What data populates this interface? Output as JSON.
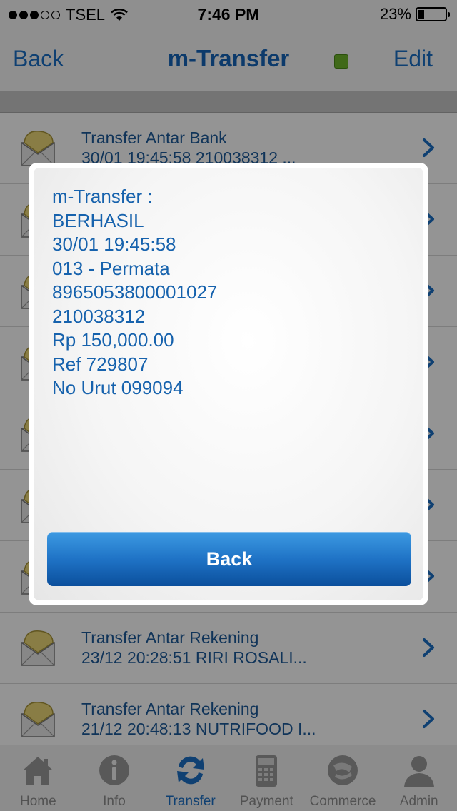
{
  "status_bar": {
    "carrier": "TSEL",
    "time": "7:46 PM",
    "battery": "23%",
    "battery_level": 0.23
  },
  "nav": {
    "back_label": "Back",
    "title": "m-Transfer",
    "edit_label": "Edit",
    "indicator_color": "#6fb52c"
  },
  "list": {
    "items": [
      {
        "title": "Transfer Antar Bank",
        "subtitle": "30/01 19:45:58 210038312 ..."
      },
      {
        "title": "",
        "subtitle": ""
      },
      {
        "title": "",
        "subtitle": ""
      },
      {
        "title": "",
        "subtitle": ""
      },
      {
        "title": "",
        "subtitle": ""
      },
      {
        "title": "",
        "subtitle": ""
      },
      {
        "title": "",
        "subtitle": ""
      },
      {
        "title": "Transfer Antar Rekening",
        "subtitle": "23/12 20:28:51 RIRI ROSALI..."
      },
      {
        "title": "Transfer Antar Rekening",
        "subtitle": "21/12 20:48:13 NUTRIFOOD I..."
      }
    ]
  },
  "modal": {
    "lines": [
      "m-Transfer :",
      "BERHASIL",
      "30/01 19:45:58",
      "013 - Permata",
      "8965053800001027",
      "210038312",
      "Rp 150,000.00",
      "Ref 729807",
      "No Urut 099094"
    ],
    "button_label": "Back"
  },
  "tabbar": {
    "tabs": [
      {
        "label": "Home",
        "icon": "home-icon"
      },
      {
        "label": "Info",
        "icon": "info-icon"
      },
      {
        "label": "Transfer",
        "icon": "transfer-icon"
      },
      {
        "label": "Payment",
        "icon": "payment-icon"
      },
      {
        "label": "Commerce",
        "icon": "commerce-icon"
      },
      {
        "label": "Admin",
        "icon": "admin-icon"
      }
    ],
    "active_tab": "Transfer"
  },
  "colors": {
    "accent": "#1a6fc4",
    "text_blue": "#1662ad"
  }
}
